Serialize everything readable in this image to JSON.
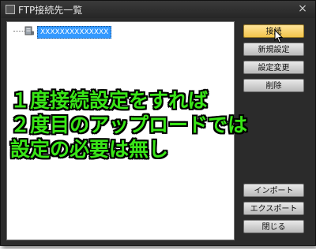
{
  "window": {
    "title": "FTP接続先一覧",
    "close_glyph": "×"
  },
  "list": {
    "items": [
      {
        "label": "XXXXXXXXXXXXXX",
        "selected": true
      }
    ]
  },
  "buttons": {
    "connect": "接続",
    "new_settings": "新規設定",
    "change_settings": "設定変更",
    "delete": "削除",
    "import": "インポート",
    "export": "エクスポート",
    "close": "閉じる"
  },
  "annotation": {
    "line1": "１度接続設定をすれば",
    "line2": "２度目のアップロードでは",
    "line3": "設定の必要は無し",
    "color": "#39e617"
  },
  "colors": {
    "dialog_bg": "#2b2b2b",
    "selection": "#3399ff",
    "primary_button": "#f3c54c"
  }
}
